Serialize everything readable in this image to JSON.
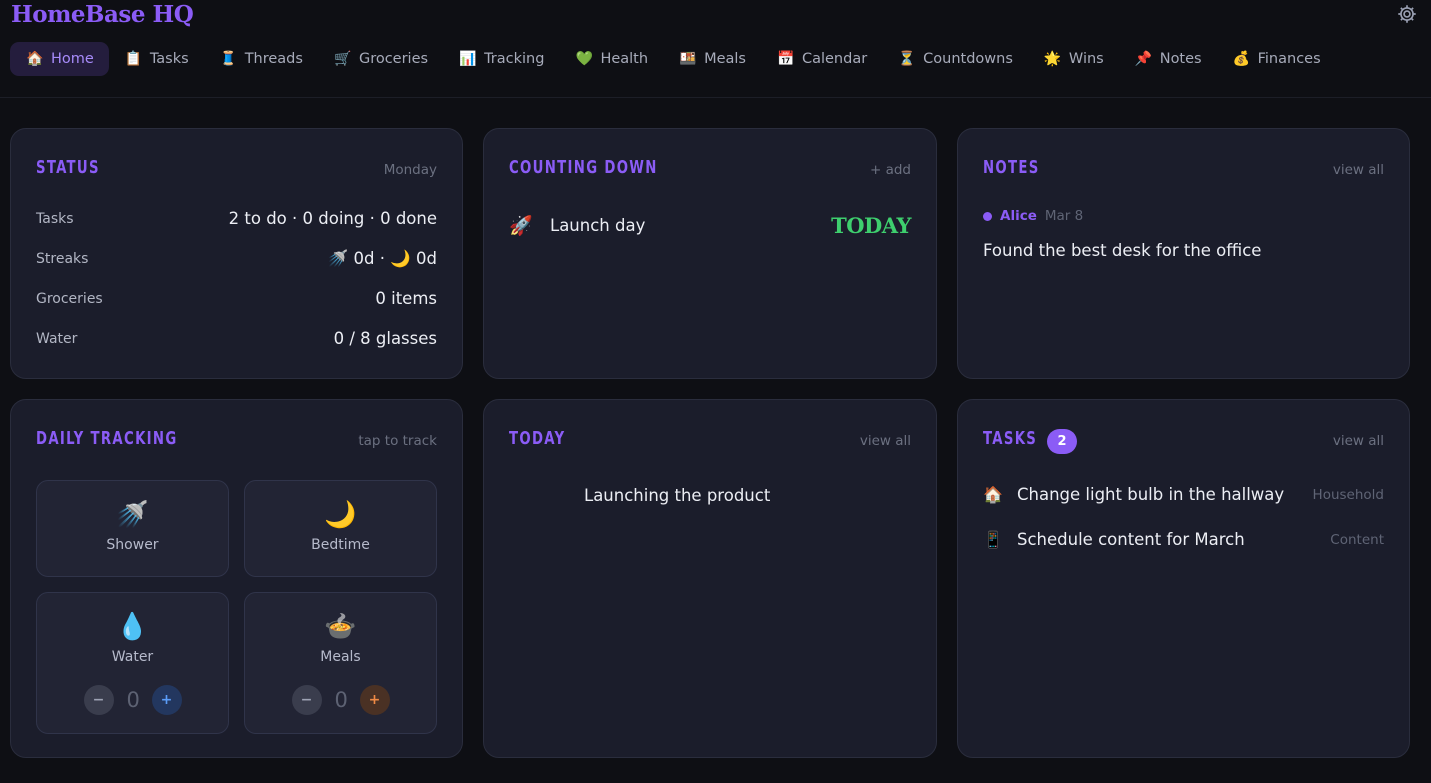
{
  "app": {
    "title": "HomeBase HQ"
  },
  "header": {
    "settings_icon": "gear-icon"
  },
  "nav": [
    {
      "label": "Home",
      "icon": "🏠",
      "active": true
    },
    {
      "label": "Tasks",
      "icon": "📋"
    },
    {
      "label": "Threads",
      "icon": "🧵"
    },
    {
      "label": "Groceries",
      "icon": "🛒"
    },
    {
      "label": "Tracking",
      "icon": "📊"
    },
    {
      "label": "Health",
      "icon": "💚"
    },
    {
      "label": "Meals",
      "icon": "🍱"
    },
    {
      "label": "Calendar",
      "icon": "📅"
    },
    {
      "label": "Countdowns",
      "icon": "⏳"
    },
    {
      "label": "Wins",
      "icon": "🌟"
    },
    {
      "label": "Notes",
      "icon": "📌"
    },
    {
      "label": "Finances",
      "icon": "💰"
    }
  ],
  "status": {
    "title": "STATUS",
    "day": "Monday",
    "rows": [
      {
        "label": "Tasks",
        "value": "2 to do · 0 doing · 0 done"
      },
      {
        "label": "Streaks",
        "value": "🚿 0d · 🌙 0d"
      },
      {
        "label": "Groceries",
        "value": "0 items"
      },
      {
        "label": "Water",
        "value": "0 / 8 glasses"
      }
    ]
  },
  "countdown": {
    "title": "COUNTING DOWN",
    "add_label": "+ add",
    "item": {
      "icon": "🚀",
      "label": "Launch day",
      "when": "TODAY"
    }
  },
  "notes": {
    "title": "NOTES",
    "view_all": "view all",
    "note": {
      "author": "Alice",
      "date": "Mar 8",
      "text": "Found the best desk for the office"
    }
  },
  "tracking": {
    "title": "DAILY TRACKING",
    "hint": "tap to track",
    "tiles": [
      {
        "label": "Shower",
        "icon": "🚿"
      },
      {
        "label": "Bedtime",
        "icon": "🌙"
      },
      {
        "label": "Water",
        "icon": "💧",
        "count": "0",
        "minus": "−",
        "plus": "+"
      },
      {
        "label": "Meals",
        "icon": "🍲",
        "count": "0",
        "minus": "−",
        "plus": "+"
      }
    ]
  },
  "today": {
    "title": "TODAY",
    "view_all": "view all",
    "item": "Launching the product"
  },
  "tasks": {
    "title": "TASKS",
    "count": "2",
    "view_all": "view all",
    "items": [
      {
        "icon": "🏠",
        "label": "Change light bulb in the hallway",
        "tag": "Household"
      },
      {
        "icon": "📱",
        "label": "Schedule content for March",
        "tag": "Content"
      }
    ]
  }
}
